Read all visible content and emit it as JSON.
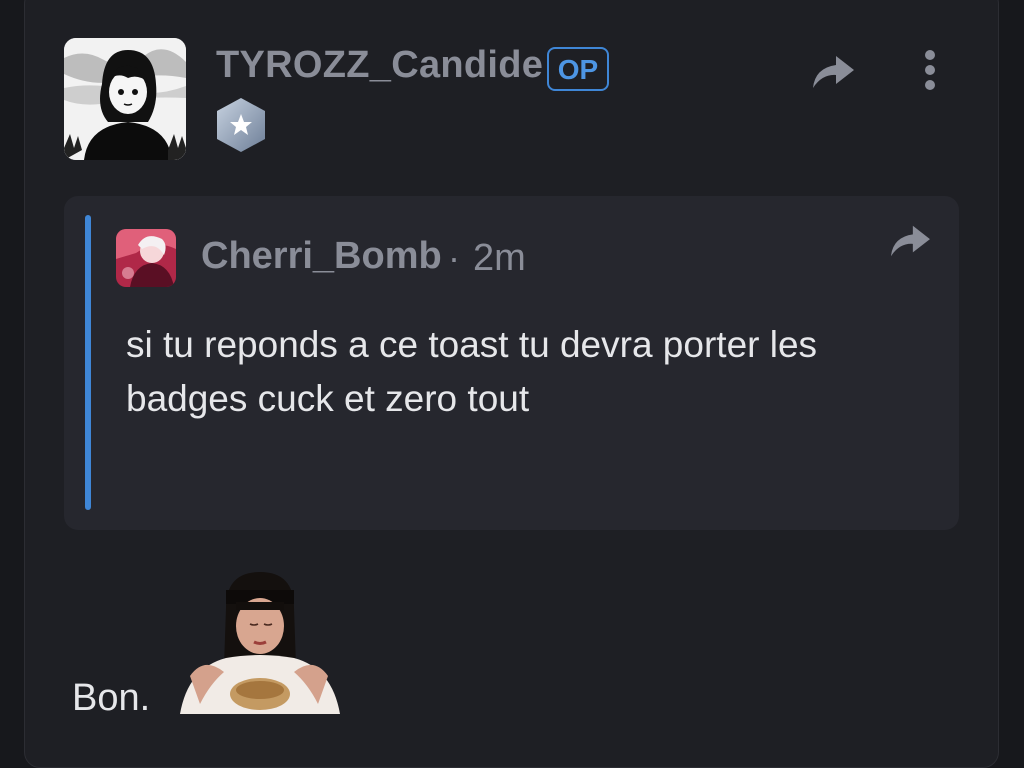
{
  "post": {
    "author": "TYROZZ_Candide",
    "op_label": "OP",
    "body": "Bon."
  },
  "quote": {
    "author": "Cherri_Bomb",
    "separator": "·",
    "time": "2m",
    "text": "si tu reponds a ce toast tu devra porter les badges cuck et zero tout"
  },
  "icons": {
    "share": "share-arrow-icon",
    "more": "more-vertical-icon",
    "level_badge": "star-hexagon-badge-icon"
  },
  "colors": {
    "background": "#17181c",
    "card": "#1e1f24",
    "quote_bg": "#26272e",
    "accent": "#3f86d6",
    "muted_text": "#8a8d98",
    "text": "#e6e7ea"
  }
}
